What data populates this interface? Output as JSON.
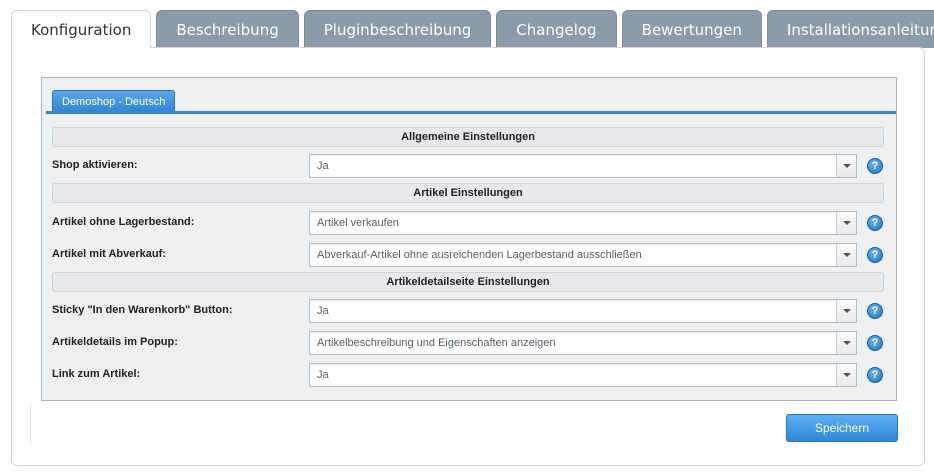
{
  "tabs": [
    {
      "label": "Konfiguration",
      "active": true
    },
    {
      "label": "Beschreibung",
      "active": false
    },
    {
      "label": "Pluginbeschreibung",
      "active": false
    },
    {
      "label": "Changelog",
      "active": false
    },
    {
      "label": "Bewertungen",
      "active": false
    },
    {
      "label": "Installationsanleitung",
      "active": false
    }
  ],
  "shop_tab": "Demoshop - Deutsch",
  "sections": {
    "general": "Allgemeine Einstellungen",
    "article": "Artikel Einstellungen",
    "detail": "Artikeldetailseite Einstellungen"
  },
  "fields": [
    {
      "label": "Shop aktivieren:",
      "value": "Ja"
    },
    {
      "label": "Artikel ohne Lagerbestand:",
      "value": "Artikel verkaufen"
    },
    {
      "label": "Artikel mit Abverkauf:",
      "value": "Abverkauf-Artikel ohne ausreichenden Lagerbestand ausschließen"
    },
    {
      "label": "Sticky \"In den Warenkorb\" Button:",
      "value": "Ja"
    },
    {
      "label": "Artikeldetails im Popup:",
      "value": "Artikelbeschreibung und Eigenschaften anzeigen"
    },
    {
      "label": "Link zum Artikel:",
      "value": "Ja"
    }
  ],
  "help_glyph": "?",
  "save_label": "Speichern",
  "colors": {
    "tab_inactive": "#8d9aa7",
    "accent_blue": "#2f86d6",
    "panel_bg": "#eef0f2"
  }
}
